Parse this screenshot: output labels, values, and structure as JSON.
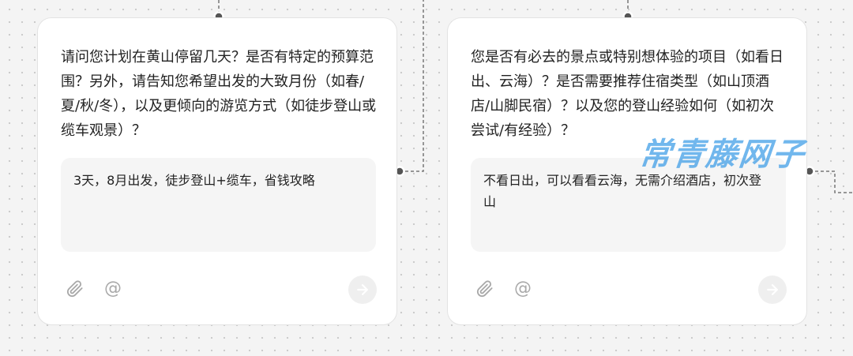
{
  "cards": [
    {
      "question": "请问您计划在黄山停留几天？是否有特定的预算范围？另外，请告知您希望出发的大致月份（如春/夏/秋/冬），以及更倾向的游览方式（如徒步登山或缆车观景）？",
      "answer": "3天，8月出发，徒步登山+缆车，省钱攻略"
    },
    {
      "question": "您是否有必去的景点或特别想体验的项目（如看日出、云海）？是否需要推荐住宿类型（如山顶酒店/山脚民宿）？以及您的登山经验如何（如初次尝试/有经验）？",
      "answer": "不看日出，可以看看云海，无需介绍酒店，初次登山"
    }
  ],
  "toolbar": {
    "attach_icon": "paperclip-icon",
    "mention_icon": "at-sign-icon",
    "mention_glyph": "@",
    "send_icon": "arrow-right-icon"
  },
  "watermark": {
    "text": "常青藤网子"
  },
  "colors": {
    "canvas_bg": "#f4f4f4",
    "card_bg": "#ffffff",
    "answer_bg": "#f5f5f5",
    "text": "#222222",
    "icon": "#a9a9a9",
    "connector": "#777777",
    "watermark": "#3498e6"
  }
}
